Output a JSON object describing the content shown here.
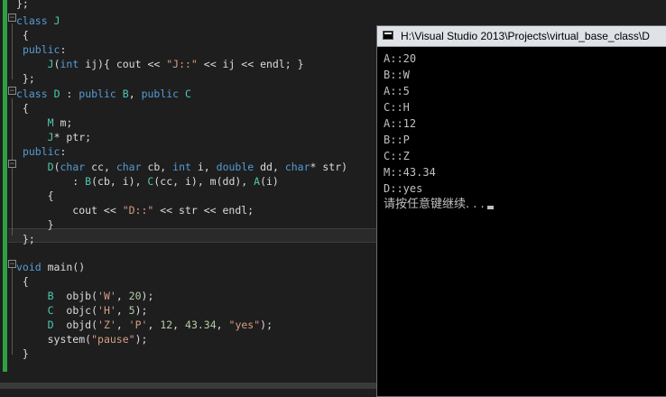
{
  "editor": {
    "lines": [
      "};",
      "class J",
      " {",
      " public:",
      "     J(int ij){ cout << \"J::\" << ij << endl; }",
      " };",
      "class D : public B, public C",
      " {",
      "     M m;",
      "     J* ptr;",
      " public:",
      "     D(char cc, char cb, int i, double dd, char* str)",
      "         : B(cb, i), C(cc, i), m(dd), A(i)",
      "     {",
      "         cout << \"D::\" << str << endl;",
      "     }",
      " };",
      "",
      "void main()",
      " {",
      "     B  objb('W', 20);",
      "     C  objc('H', 5);",
      "     D  objd('Z', 'P', 12, 43.34, \"yes\");",
      "     system(\"pause\");",
      " }"
    ]
  },
  "console": {
    "title": "H:\\Visual Studio 2013\\Projects\\virtual_base_class\\D",
    "output": [
      "A::20",
      "B::W",
      "A::5",
      "C::H",
      "A::12",
      "B::P",
      "C::Z",
      "M::43.34",
      "D::yes",
      "请按任意键继续. . ."
    ]
  }
}
